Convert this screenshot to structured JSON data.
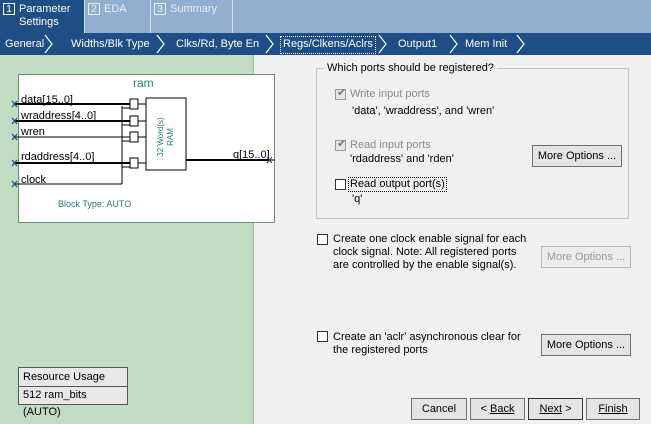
{
  "top_tabs": [
    {
      "num": "1",
      "label": "Parameter\nSettings"
    },
    {
      "num": "2",
      "label": "EDA"
    },
    {
      "num": "3",
      "label": "Summary"
    }
  ],
  "sub_tabs": [
    "General",
    "Widths/Blk Type",
    "Clks/Rd, Byte En",
    "Regs/Clkens/Aclrs",
    "Output1",
    "Mem Init"
  ],
  "diagram": {
    "title": "ram",
    "ports": [
      "data[15..0]",
      "wraddress[4..0]",
      "wren",
      "rdaddress[4..0]",
      "clock"
    ],
    "output": "q[15..0]",
    "block_line1": "32 Word(s)",
    "block_line2": "RAM",
    "block_type": "Block Type: AUTO"
  },
  "resource": {
    "header": "Resource Usage",
    "value": "512 ram_bits (AUTO)"
  },
  "group_title": "Which ports should be registered?",
  "write_ports": {
    "label": "Write input ports",
    "desc": "'data', 'wraddress', and 'wren'"
  },
  "read_ports": {
    "label": "Read input ports",
    "desc": "'rdaddress' and 'rden'"
  },
  "read_output": {
    "label": "Read output port(s)",
    "desc": "'q'"
  },
  "clock_enable": {
    "line1": "Create one clock enable signal for each",
    "line2": "clock signal.  Note: All registered ports",
    "line3": "are controlled by the enable signal(s)."
  },
  "aclr": {
    "line1": "Create an 'aclr' asynchronous clear for",
    "line2": "the registered ports"
  },
  "more_options": "More Options ...",
  "buttons": {
    "cancel": "Cancel",
    "back": "Back",
    "next": "Next",
    "finish": "Finish"
  }
}
